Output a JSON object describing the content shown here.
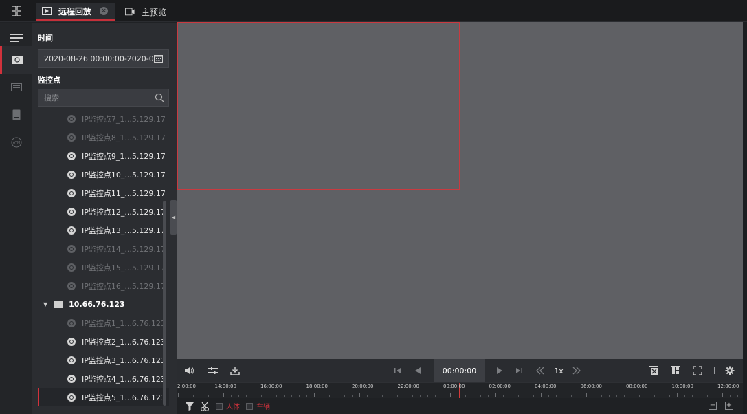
{
  "tabs": [
    {
      "label": "远程回放",
      "active": true
    },
    {
      "label": "主预览",
      "active": false
    }
  ],
  "panel": {
    "time_title": "时间",
    "time_range": "2020-08-26 00:00:00-2020-0...",
    "monitor_title": "监控点",
    "search_placeholder": "搜索",
    "tree": [
      {
        "label": "IP监控点7_1...5.129.17",
        "status": "offline"
      },
      {
        "label": "IP监控点8_1...5.129.17",
        "status": "offline"
      },
      {
        "label": "IP监控点9_1...5.129.17",
        "status": "online"
      },
      {
        "label": "IP监控点10_...5.129.17",
        "status": "online"
      },
      {
        "label": "IP监控点11_...5.129.17",
        "status": "online"
      },
      {
        "label": "IP监控点12_...5.129.17",
        "status": "online"
      },
      {
        "label": "IP监控点13_...5.129.17",
        "status": "online"
      },
      {
        "label": "IP监控点14_...5.129.17",
        "status": "offline"
      },
      {
        "label": "IP监控点15_...5.129.17",
        "status": "offline"
      },
      {
        "label": "IP监控点16_...5.129.17",
        "status": "offline"
      },
      {
        "label": "10.66.76.123",
        "status": "group"
      },
      {
        "label": "IP监控点1_1...6.76.123",
        "status": "offline"
      },
      {
        "label": "IP监控点2_1...6.76.123",
        "status": "online"
      },
      {
        "label": "IP监控点3_1...6.76.123",
        "status": "online"
      },
      {
        "label": "IP监控点4_1...6.76.123",
        "status": "online"
      },
      {
        "label": "IP监控点5_1...6.76.123",
        "status": "online",
        "selected": true
      }
    ]
  },
  "controls": {
    "current_time": "00:00:00",
    "speed": "1x"
  },
  "timeline": {
    "labels": [
      "2:00:00",
      "14:00:00",
      "16:00:00",
      "18:00:00",
      "20:00:00",
      "22:00:00",
      "00:00:00",
      "02:00:00",
      "04:00:00",
      "06:00:00",
      "08:00:00",
      "10:00:00",
      "12:00:00"
    ]
  },
  "filters": {
    "human_label": "人体",
    "vehicle_label": "车辆"
  },
  "colors": {
    "accent": "#d2323c",
    "cell": "#5f6064"
  }
}
